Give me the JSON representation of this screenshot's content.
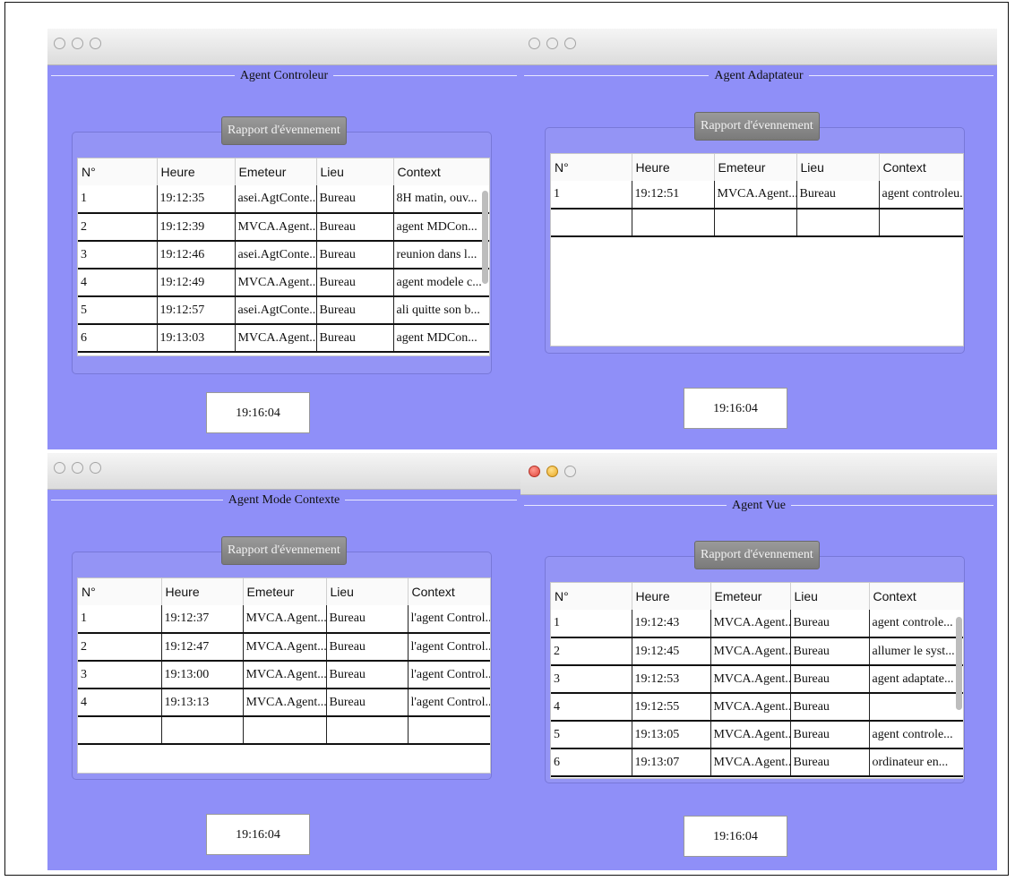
{
  "panels": [
    {
      "agent_title": "Agent Controleur",
      "tab_label": "Rapport d'évennement",
      "columns": [
        "N°",
        "Heure",
        "Emeteur",
        "Lieu",
        "Context"
      ],
      "rows": [
        [
          "1",
          "19:12:35",
          "asei.AgtConte...",
          "Bureau",
          "8H matin, ouv..."
        ],
        [
          "2",
          "19:12:39",
          "MVCA.Agent...",
          "Bureau",
          "agent MDCon..."
        ],
        [
          "3",
          "19:12:46",
          "asei.AgtConte...",
          "Bureau",
          "reunion dans l..."
        ],
        [
          "4",
          "19:12:49",
          "MVCA.Agent...",
          "Bureau",
          "agent modele c..."
        ],
        [
          "5",
          "19:12:57",
          "asei.AgtConte...",
          "Bureau",
          "ali quitte son b..."
        ],
        [
          "6",
          "19:13:03",
          "MVCA.Agent...",
          "Bureau",
          "agent MDCon..."
        ]
      ],
      "clock": "19:16:04"
    },
    {
      "agent_title": "Agent Adaptateur",
      "tab_label": "Rapport d'évennement",
      "columns": [
        "N°",
        "Heure",
        "Emeteur",
        "Lieu",
        "Context"
      ],
      "rows": [
        [
          "1",
          "19:12:51",
          "MVCA.Agent...",
          "Bureau",
          "agent controleu..."
        ],
        [
          "",
          "",
          "",
          "",
          ""
        ]
      ],
      "clock": "19:16:04"
    },
    {
      "agent_title": "Agent Mode Contexte",
      "tab_label": "Rapport d'évennement",
      "columns": [
        "N°",
        "Heure",
        "Emeteur",
        "Lieu",
        "Context"
      ],
      "rows": [
        [
          "1",
          "19:12:37",
          "MVCA.Agent...",
          "Bureau",
          "l'agent Control..."
        ],
        [
          "2",
          "19:12:47",
          "MVCA.Agent...",
          "Bureau",
          "l'agent Control..."
        ],
        [
          "3",
          "19:13:00",
          "MVCA.Agent...",
          "Bureau",
          "l'agent Control..."
        ],
        [
          "4",
          "19:13:13",
          "MVCA.Agent...",
          "Bureau",
          "l'agent Control..."
        ],
        [
          "",
          "",
          "",
          "",
          ""
        ]
      ],
      "clock": "19:16:04"
    },
    {
      "agent_title": "Agent Vue",
      "tab_label": "Rapport d'évennement",
      "columns": [
        "N°",
        "Heure",
        "Emeteur",
        "Lieu",
        "Context"
      ],
      "rows": [
        [
          "1",
          "19:12:43",
          "MVCA.Agent...",
          "Bureau",
          "agent controle..."
        ],
        [
          "2",
          "19:12:45",
          "MVCA.Agent...",
          "Bureau",
          "allumer le syst..."
        ],
        [
          "3",
          "19:12:53",
          "MVCA.Agent...",
          "Bureau",
          "agent adaptate..."
        ],
        [
          "4",
          "19:12:55",
          "MVCA.Agent...",
          "Bureau",
          ""
        ],
        [
          "5",
          "19:13:05",
          "MVCA.Agent...",
          "Bureau",
          "agent controle..."
        ],
        [
          "6",
          "19:13:07",
          "MVCA.Agent...",
          "Bureau",
          "ordinateur en..."
        ]
      ],
      "clock": "19:16:04"
    }
  ],
  "colors": {
    "window_bg": "#8f8ff8",
    "titlebar": "#e6e6e6"
  }
}
